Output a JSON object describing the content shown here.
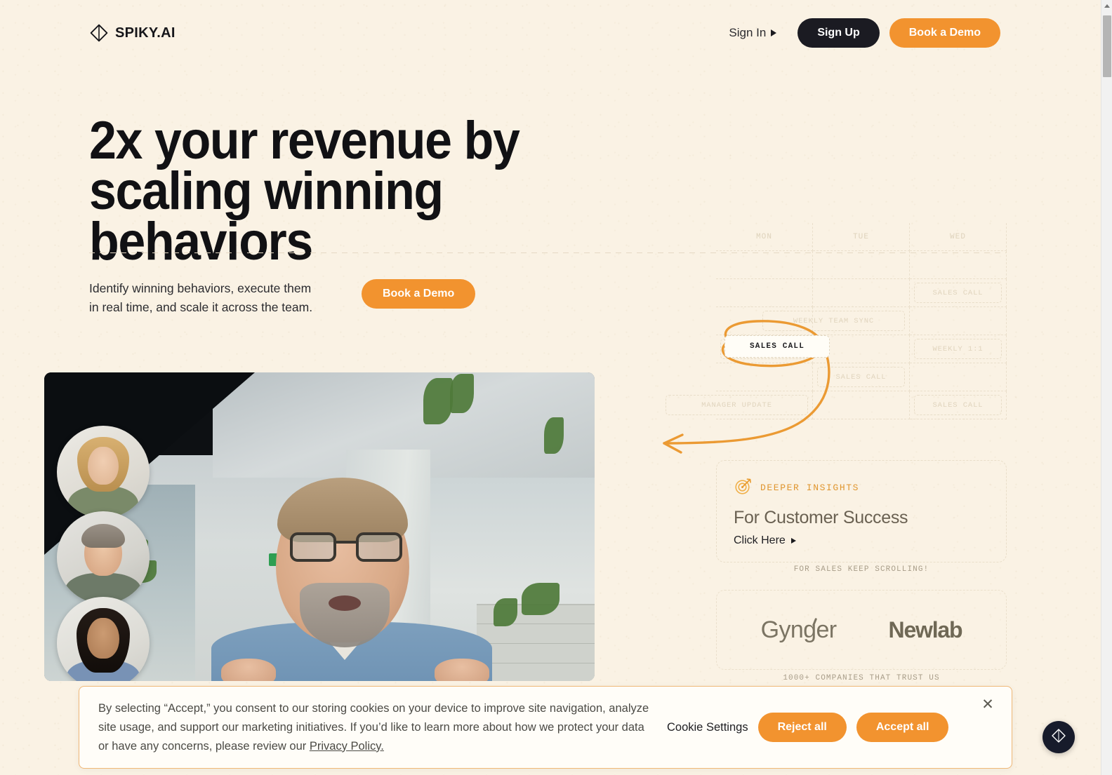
{
  "brand": {
    "name": "SPIKY.AI",
    "logo_icon": "spiky-diamond-icon"
  },
  "nav": {
    "signin": "Sign In",
    "signup": "Sign Up",
    "demo": "Book a Demo"
  },
  "hero": {
    "headline_line1": "2x your revenue by",
    "headline_line2": "scaling winning behaviors",
    "subtext": "Identify winning behaviors, execute them in real time, and scale it across the team.",
    "cta": "Book a Demo"
  },
  "video": {
    "participants": [
      "participant-1",
      "participant-2",
      "participant-3"
    ]
  },
  "calendar": {
    "days": [
      "MON",
      "TUE",
      "WED"
    ],
    "events": [
      {
        "day": 2,
        "row": 1,
        "label": "SALES CALL"
      },
      {
        "day": 1,
        "row": 2,
        "label": "WEEKLY TEAM SYNC"
      },
      {
        "day": 0,
        "row": 3,
        "label": "SALES CALL"
      },
      {
        "day": 2,
        "row": 3,
        "label": "WEEKLY 1:1"
      },
      {
        "day": 1,
        "row": 4,
        "label": "SALES CALL"
      },
      {
        "day": 2,
        "row": 5,
        "label": "SALES CALL"
      },
      {
        "day": 0,
        "row": 5,
        "label": "MANAGER UPDATE"
      }
    ],
    "highlight": "SALES CALL"
  },
  "insight": {
    "tag": "DEEPER INSIGHTS",
    "tag_icon": "target-dart-icon",
    "title": "For Customer Success",
    "link": "Click Here",
    "scroll_note": "FOR SALES KEEP SCROLLING!"
  },
  "logos": {
    "brands": [
      "Gynger",
      "Newlab"
    ],
    "trust_note": "1000+ COMPANIES THAT TRUST US"
  },
  "cookie": {
    "body_1": "By selecting “Accept,” you consent to our storing cookies on your device to improve site navigation, analyze site usage, and support our marketing initiatives. If you’d like to learn more about how we protect your data or have any concerns, please review our ",
    "privacy_link": "Privacy Policy.",
    "settings": "Cookie Settings",
    "reject": "Reject all",
    "accept": "Accept all",
    "close_icon": "close-icon"
  },
  "fab": {
    "icon": "spiky-diamond-icon"
  },
  "colors": {
    "background": "#faf2e4",
    "accent_orange": "#f2932f",
    "dark": "#1b1b22",
    "muted": "#6a6152"
  }
}
